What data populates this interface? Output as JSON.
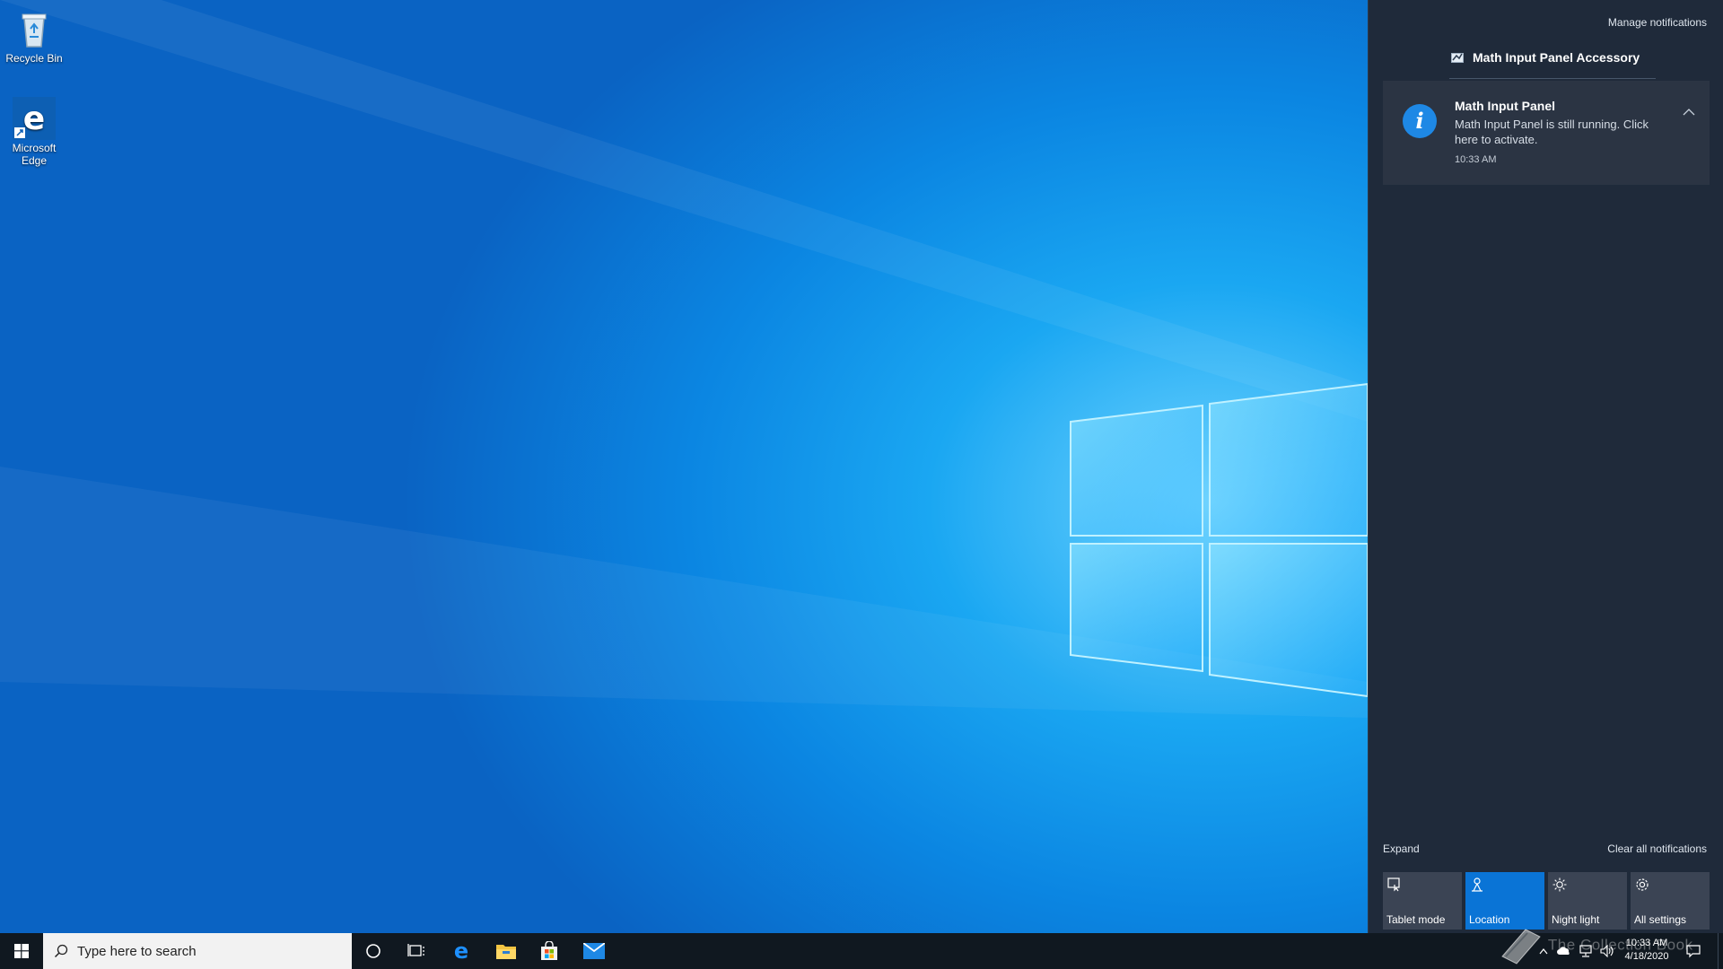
{
  "desktop": {
    "icons": [
      {
        "label": "Recycle Bin",
        "icon": "recycle-bin-icon"
      },
      {
        "label": "Microsoft Edge",
        "icon": "edge-icon"
      }
    ]
  },
  "action_center": {
    "manage_notifications": "Manage notifications",
    "group_header": "Math Input Panel Accessory",
    "notification": {
      "title": "Math Input Panel",
      "body": "Math Input Panel is still running. Click here to activate.",
      "time": "10:33 AM",
      "icon": "info-icon"
    },
    "expand": "Expand",
    "clear_all": "Clear all notifications",
    "quick_actions": [
      {
        "label": "Tablet mode",
        "icon": "tablet-mode-icon",
        "active": false
      },
      {
        "label": "Location",
        "icon": "location-icon",
        "active": true
      },
      {
        "label": "Night light",
        "icon": "night-light-icon",
        "active": false
      },
      {
        "label": "All settings",
        "icon": "gear-icon",
        "active": false
      }
    ]
  },
  "taskbar": {
    "search_placeholder": "Type here to search",
    "pinned": [
      "edge-icon",
      "file-explorer-icon",
      "store-icon",
      "mail-icon"
    ],
    "clock_time": "10:33 AM",
    "clock_date": "4/18/2020",
    "watermark": "The Collection Book"
  },
  "colors": {
    "accent": "#0a74d6",
    "action_center_bg": "#1f2a3a",
    "taskbar_bg": "#101820"
  }
}
